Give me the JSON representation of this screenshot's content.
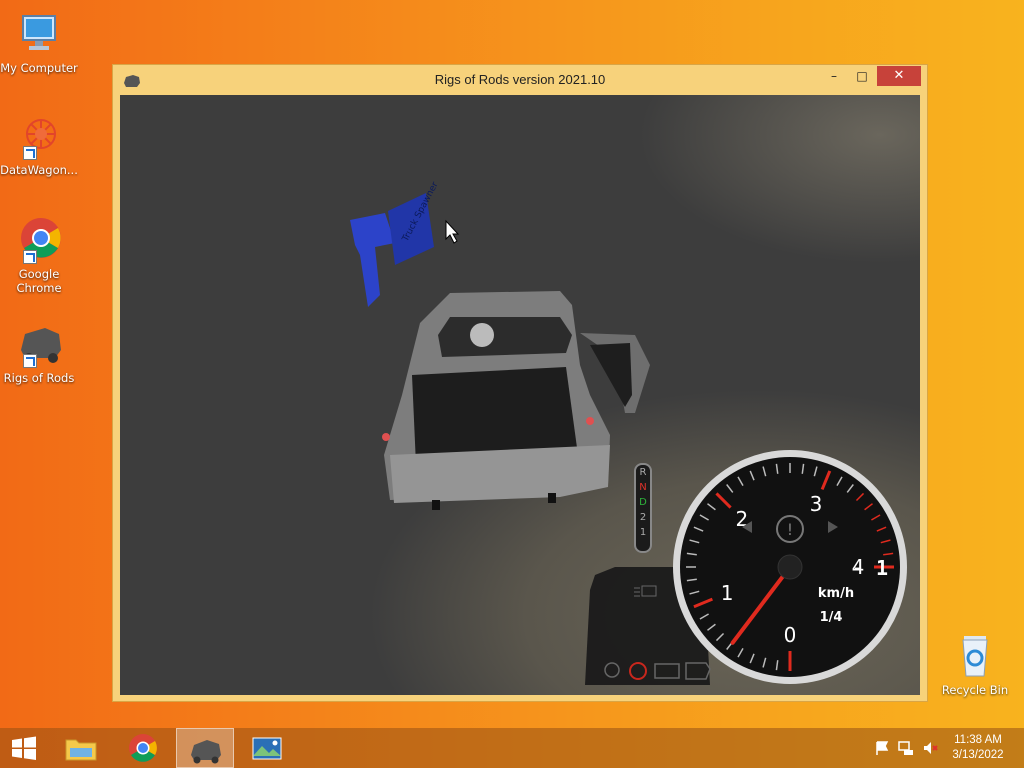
{
  "desktop": {
    "icons": [
      {
        "label": "My Computer"
      },
      {
        "label": "DataWagon..."
      },
      {
        "label": "Google Chrome"
      },
      {
        "label": "Rigs of Rods"
      },
      {
        "label": "Recycle Bin"
      }
    ]
  },
  "window": {
    "title": "Rigs of Rods version 2021.10",
    "minimize": "–",
    "maximize": "□",
    "close": "✕"
  },
  "game": {
    "sign_text": "Truck Spawner",
    "gears": [
      "R",
      "N",
      "D",
      "2",
      "1"
    ],
    "selected_gear": "D",
    "speedometer": {
      "ticks": [
        "0",
        "1",
        "2",
        "3",
        "4"
      ],
      "unit": "km/h",
      "ratio": "1/4",
      "digital": "- 1",
      "needle_value": 0.55
    }
  },
  "taskbar": {
    "time": "11:38 AM",
    "date": "3/13/2022"
  },
  "colors": {
    "accent_red": "#e02a1e",
    "close_button": "#c7423a",
    "window_frame": "#f7d27b"
  }
}
